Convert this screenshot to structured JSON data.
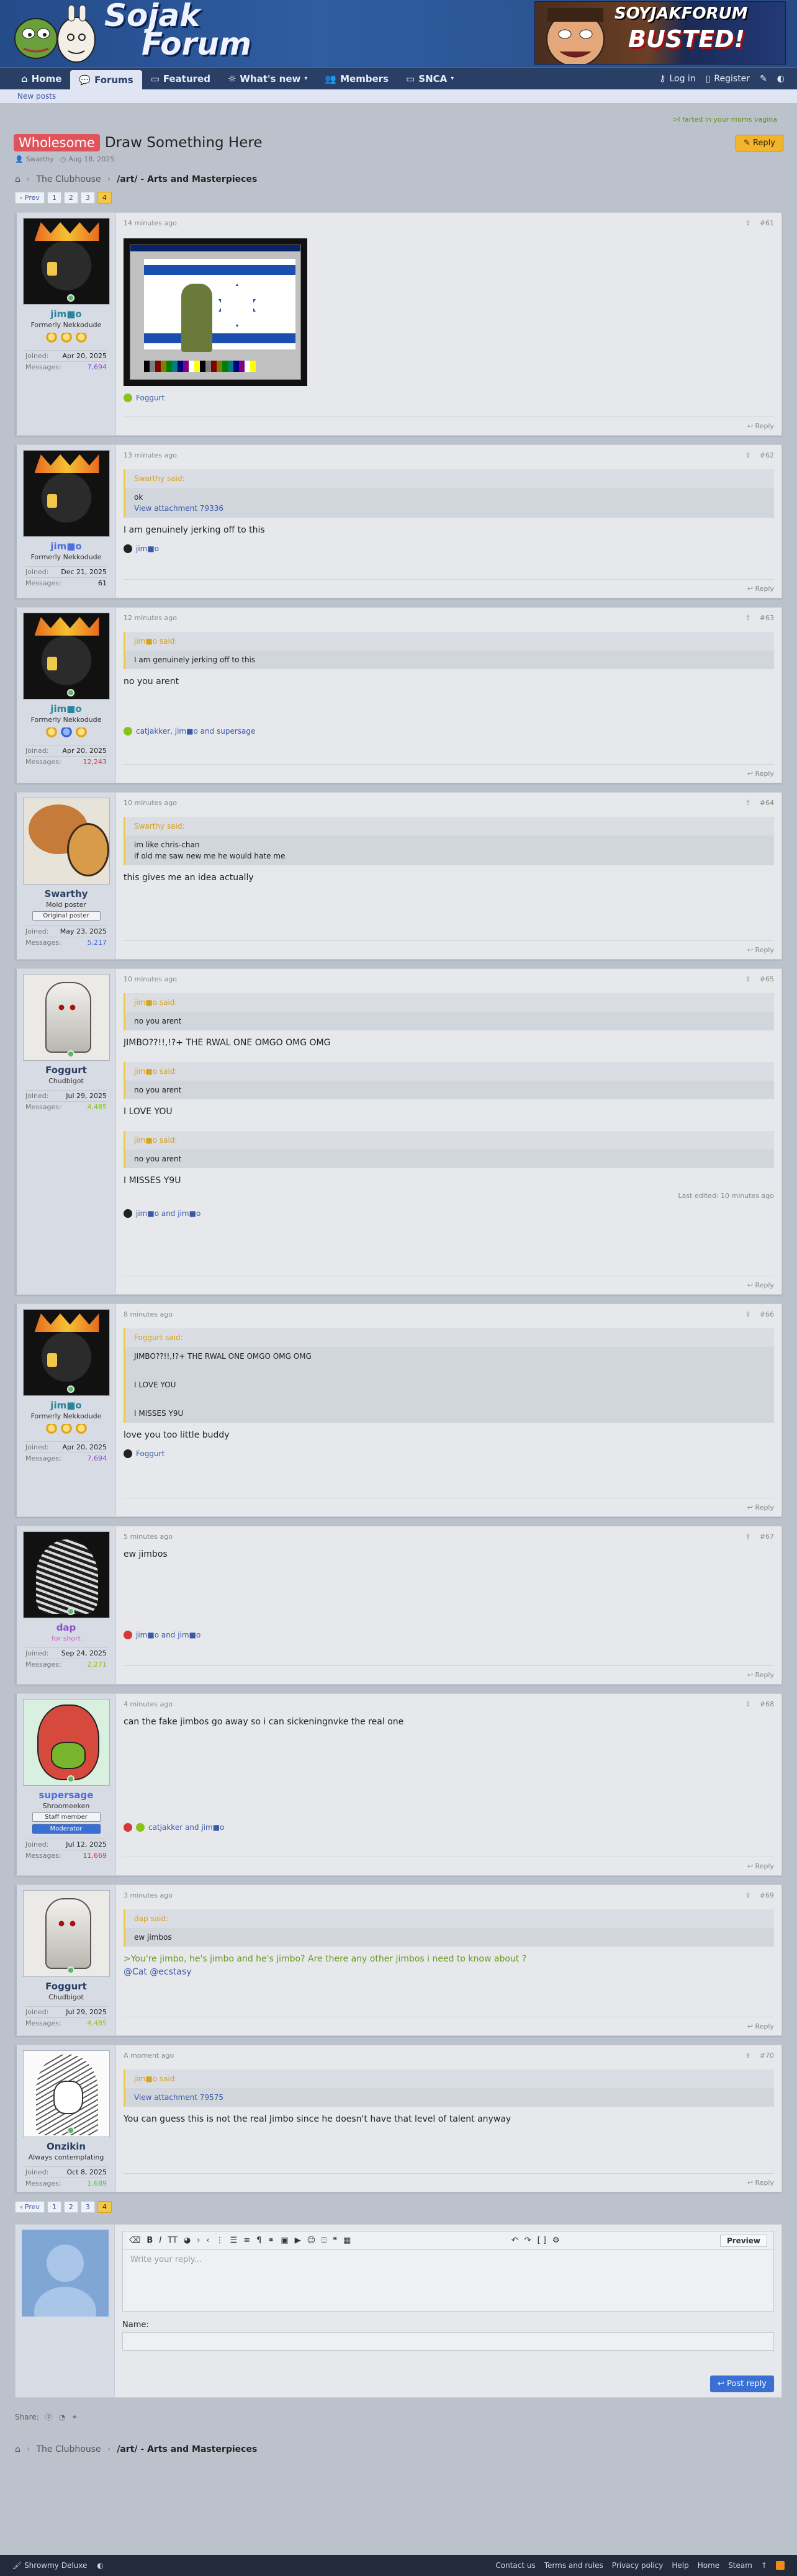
{
  "header": {
    "logo_line1": "Sojak",
    "logo_line2": "Forum",
    "promo_line1": "SOYJAKFORUM",
    "promo_line2": "BUSTED!"
  },
  "nav": {
    "items": [
      "Home",
      "Forums",
      "Featured",
      "What's new",
      "Members",
      "SNCA"
    ],
    "login": "Log in",
    "register": "Register"
  },
  "subnav": {
    "new_posts": "New posts"
  },
  "notice": ">I farted in your moms vagina",
  "thread": {
    "prefix": "Wholesome",
    "title": "Draw Something Here",
    "author": "Swarthy",
    "date": "Aug 18, 2025",
    "reply_label": "Reply"
  },
  "breadcrumb": {
    "items": [
      "The Clubhouse",
      "/art/ - Arts and Masterpieces"
    ]
  },
  "pager": {
    "prev": "‹ Prev",
    "pages": [
      "1",
      "2",
      "3",
      "4"
    ],
    "current": "4"
  },
  "posts": [
    {
      "user": "jim■o",
      "user_title": "Formerly Nekkodude",
      "joined": "Apr 20, 2025",
      "messages": "7,694",
      "time": "14 minutes ago",
      "num": "#61",
      "reaction_text": "Foggurt",
      "reply": "Reply"
    },
    {
      "user": "jim■o",
      "user_title": "Formerly Nekkodude",
      "joined": "Dec 21, 2025",
      "messages": "61",
      "time": "13 minutes ago",
      "num": "#62",
      "quote_author": "Swarthy said:",
      "quote_lines": [
        "ok",
        "View attachment 79336"
      ],
      "body": "I am genuinely jerking off to this",
      "reaction_text": "jim■o",
      "reply": "Reply"
    },
    {
      "user": "jim■o",
      "user_title": "Formerly Nekkodude",
      "joined": "Apr 20, 2025",
      "messages": "12,243",
      "time": "12 minutes ago",
      "num": "#63",
      "quote_author": "jim■o said:",
      "quote_lines": [
        "I am genuinely jerking off to this"
      ],
      "body": "no you arent",
      "reaction_text": "catjakker, jim■o and supersage",
      "reply": "Reply"
    },
    {
      "user": "Swarthy",
      "user_title": "Mold poster",
      "badge": "Original poster",
      "joined": "May 23, 2025",
      "messages": "5,217",
      "time": "10 minutes ago",
      "num": "#64",
      "quote_author": "Swarthy said:",
      "quote_lines": [
        "im like chris-chan",
        "if old me saw new me he would hate me"
      ],
      "body": "this gives me an idea actually",
      "reply": "Reply"
    },
    {
      "user": "Foggurt",
      "user_title": "Chudbigot",
      "joined": "Jul 29, 2025",
      "messages": "4,485",
      "time": "10 minutes ago",
      "num": "#65",
      "quote_author": "jim■o said:",
      "quote_lines": [
        "no you arent"
      ],
      "body": "JIMBO??!!,!?+ THE RWAL ONE OMGO OMG OMG",
      "quote2_author": "jim■o said:",
      "quote2_lines": [
        "no you arent"
      ],
      "body2": "I LOVE YOU",
      "quote3_author": "jim■o said:",
      "quote3_lines": [
        "no you arent"
      ],
      "body3": "I MISSES Y9U",
      "edit_note": "Last edited: 10 minutes ago",
      "reaction_text": "jim■o and jim■o",
      "reply": "Reply"
    },
    {
      "user": "jim■o",
      "user_title": "Formerly Nekkodude",
      "joined": "Apr 20, 2025",
      "messages": "7,694",
      "time": "8 minutes ago",
      "num": "#66",
      "quote_author": "Foggurt said:",
      "quote_lines": [
        "JIMBO??!!,!?+ THE RWAL ONE OMGO OMG OMG",
        "",
        "I LOVE YOU",
        "",
        "I MISSES Y9U"
      ],
      "body": "love you too little buddy",
      "reaction_text": "Foggurt",
      "reply": "Reply"
    },
    {
      "user": "dap",
      "user_title": "for short",
      "joined": "Sep 24, 2025",
      "messages": "2,271",
      "time": "5 minutes ago",
      "num": "#67",
      "body": "ew jimbos",
      "reaction_text": "jim■o      and jim■o",
      "reply": "Reply"
    },
    {
      "user": "supersage",
      "user_title": "Shroomeeken",
      "badge": "Staff member",
      "badge2": "Moderator",
      "joined": "Jul 12, 2025",
      "messages": "11,669",
      "time": "4 minutes ago",
      "num": "#68",
      "body": "can the fake jimbos go away so i can sickeningnvke the real one",
      "reaction_text": "catjakker and jim■o",
      "reply": "Reply"
    },
    {
      "user": "Foggurt",
      "user_title": "Chudbigot",
      "joined": "Jul 29, 2025",
      "messages": "4,485",
      "time": "3 minutes ago",
      "num": "#69",
      "quote_author": "dap said:",
      "quote_lines": [
        "ew jimbos"
      ],
      "body": ">You're jimbo, he's jimbo and he's jimbo? Are there any other jimbos i need to know about ?",
      "body_line2": "@Cat @ecstasy",
      "reply": "Reply"
    },
    {
      "user": "Onzikin",
      "user_title": "Always contemplating",
      "joined": "Oct 8, 2025",
      "messages": "1,689",
      "time": "A moment ago",
      "num": "#70",
      "quote_author": "jim■o said:",
      "quote_lines": [
        "View attachment 79575"
      ],
      "body": "You can guess this is not the real Jimbo since he doesn't have that level of talent anyway",
      "reply": "Reply"
    }
  ],
  "reply_form": {
    "placeholder": "Write your reply...",
    "preview": "Preview",
    "name_label": "Name:",
    "post_button": "Post reply"
  },
  "share": {
    "label": "Share:"
  },
  "footer": {
    "style": "Shrowmy Deluxe",
    "links": [
      "Contact us",
      "Terms and rules",
      "Privacy policy",
      "Help",
      "Home",
      "Steam"
    ]
  },
  "colors": {
    "accent": "#3a6fd4",
    "prefix": "#e0535a",
    "reply": "#f2b42b",
    "nav": "#2a3f66"
  }
}
